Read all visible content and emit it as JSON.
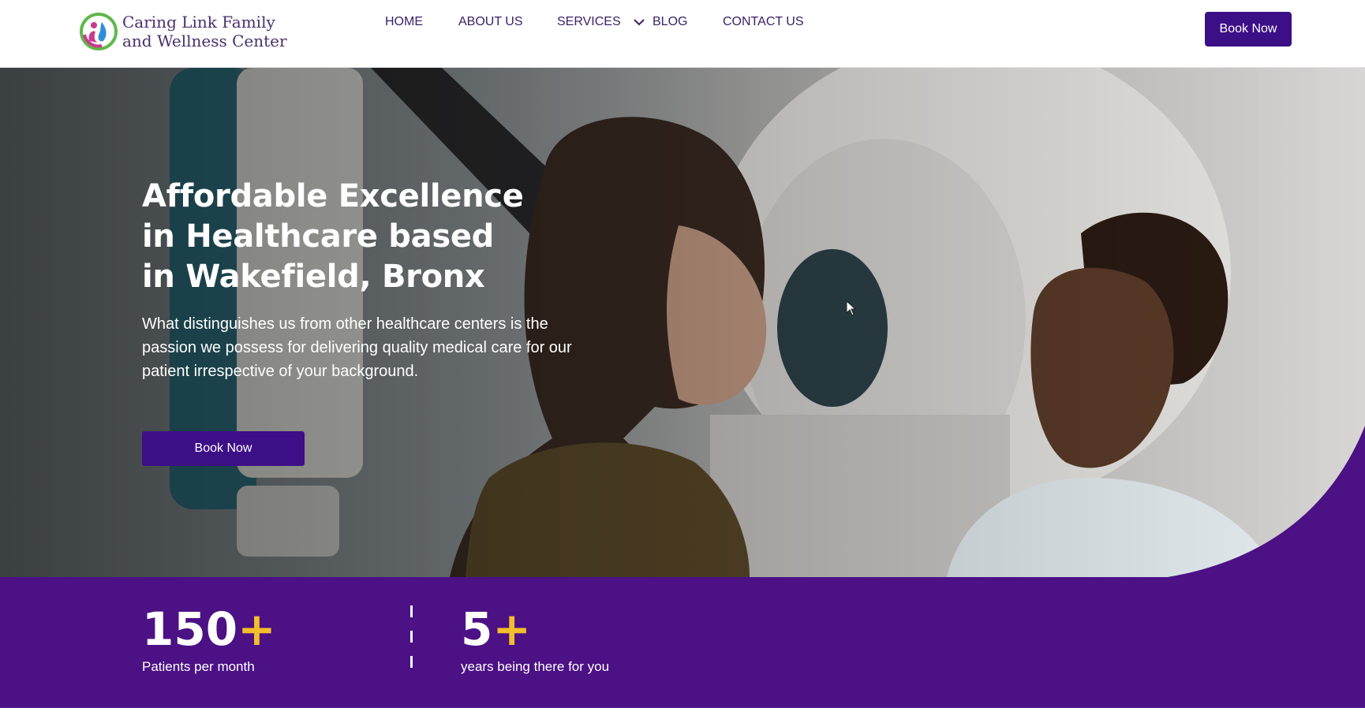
{
  "header": {
    "logo_line1": "Caring Link Family",
    "logo_line2": "and Wellness Center",
    "nav": {
      "home": "HOME",
      "about": "ABOUT US",
      "services": "SERVICES",
      "blog": "BLOG",
      "contact": "CONTACT US"
    },
    "book_label": "Book Now"
  },
  "hero": {
    "title_line1": "Affordable Excellence",
    "title_line2": "in Healthcare based",
    "title_line3": "in Wakefield, Bronx",
    "subtitle": "What distinguishes us from other healthcare centers is the passion we possess for delivering quality medical care for our patient irrespective of your background.",
    "book_label": "Book Now"
  },
  "stats": [
    {
      "number": "150",
      "suffix": "+",
      "label": "Patients per month"
    },
    {
      "number": "5",
      "suffix": "+",
      "label": "years being there for you"
    }
  ],
  "colors": {
    "brand_purple": "#4b1185",
    "button_purple": "#3d0f87",
    "accent_gold": "#f2be2c",
    "nav_text": "#3b1f66"
  },
  "icons": {
    "logo": "caring-link-logo-icon",
    "services_dropdown": "chevron-down-icon",
    "pointer": "mouse-cursor-icon"
  }
}
